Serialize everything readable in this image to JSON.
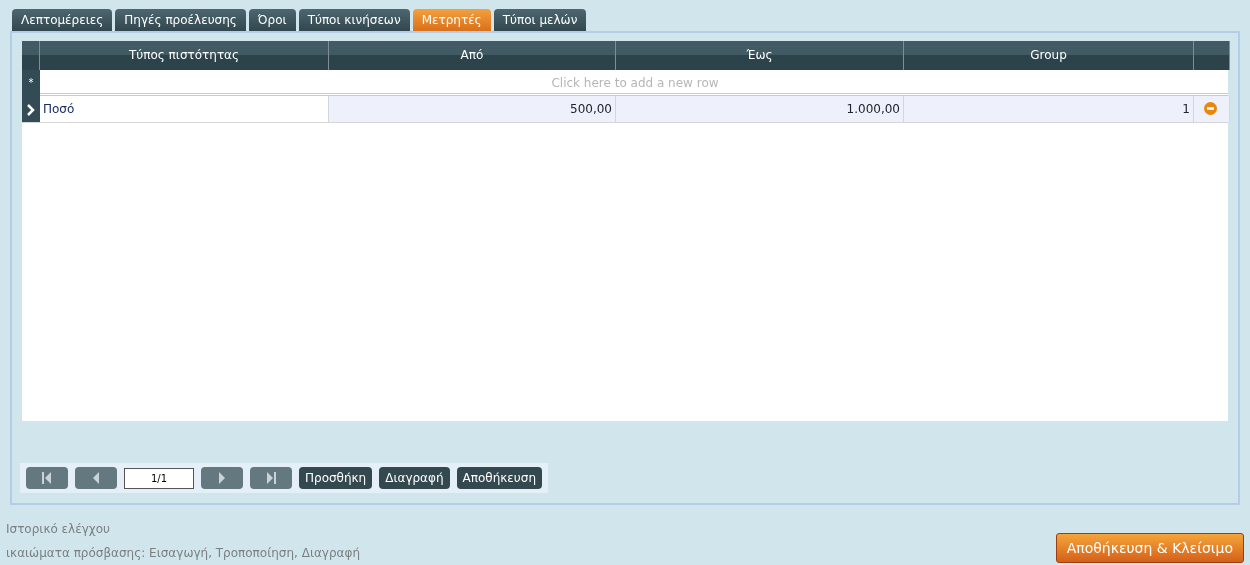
{
  "tabs": [
    {
      "label": "Λεπτομέρειες",
      "selected": false
    },
    {
      "label": "Πηγές προέλευσης",
      "selected": false
    },
    {
      "label": "Όροι",
      "selected": false
    },
    {
      "label": "Τύποι κινήσεων",
      "selected": false
    },
    {
      "label": "Μετρητές",
      "selected": true
    },
    {
      "label": "Τύποι μελών",
      "selected": false
    }
  ],
  "grid": {
    "columns": [
      "Τύπος πιστότητας",
      "Από",
      "Έως",
      "Group"
    ],
    "new_row_marker": "*",
    "new_row_hint": "Click here to add a new row",
    "rows": [
      {
        "selected": true,
        "cells": [
          "Ποσό",
          "500,00",
          "1.000,00",
          "1"
        ]
      }
    ]
  },
  "pager": {
    "page": "1/1",
    "buttons": [
      "Προσθήκη",
      "Διαγραφή",
      "Αποθήκευση"
    ]
  },
  "footer": {
    "audit": "Ιστορικό ελέγχου",
    "permissions": "ικαιώματα πρόσβασης:  Εισαγωγή, Τροποποίηση, Διαγραφή",
    "save_close": "Αποθήκευση & Κλείσιμο"
  }
}
